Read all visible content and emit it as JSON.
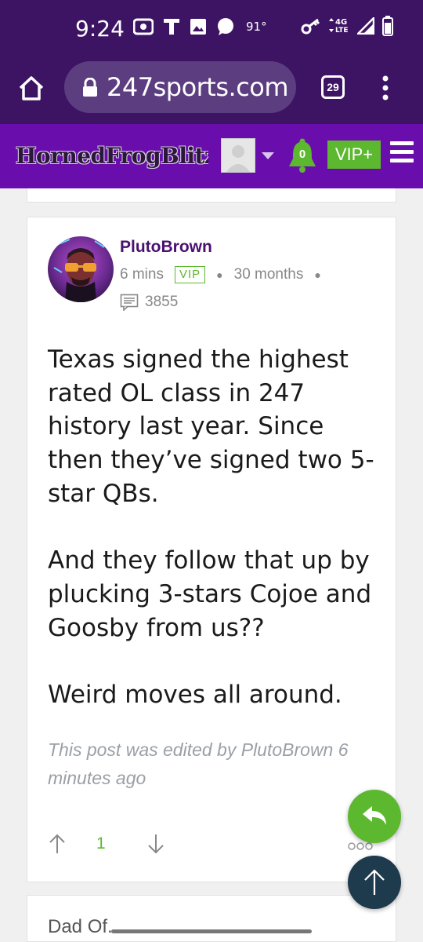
{
  "status_bar": {
    "time": "9:24",
    "temperature": "91°",
    "network": "4G LTE"
  },
  "browser": {
    "url": "247sports.com",
    "tab_count": "29"
  },
  "site_header": {
    "logo_text": "HornedFrogBlitz",
    "notification_count": "0",
    "vip_label": "VIP+"
  },
  "post": {
    "author": "PlutoBrown",
    "time_ago": "6 mins",
    "badge": "VIP",
    "membership": "30 months",
    "post_count": "3855",
    "paragraphs": [
      "Texas signed the highest rated OL class in 247 history last year. Since then they’ve signed two 5-star QBs.",
      "And they follow that up by plucking 3-stars Cojoe and Goosby from us??",
      "Weird moves all around."
    ],
    "edited_note": "This post was edited by PlutoBrown 6 minutes ago",
    "vote_count": "1"
  },
  "next_post": {
    "partial_text": "Dad Of..."
  },
  "colors": {
    "status_bg": "#3d1463",
    "site_header_bg": "#6a0dad",
    "accent_green": "#5cb82e",
    "author_purple": "#4a1070",
    "top_fab": "#1e3a4d"
  }
}
